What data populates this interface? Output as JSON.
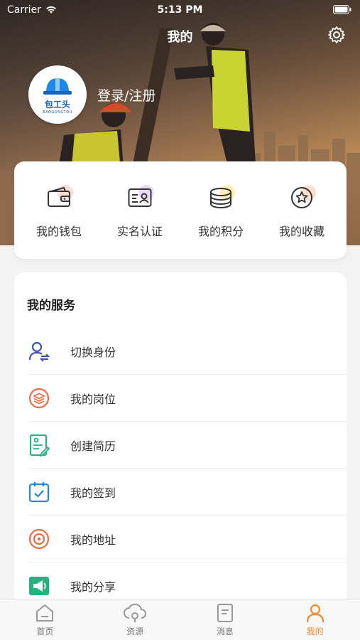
{
  "status_bar": {
    "carrier": "Carrier",
    "time": "5:13 PM"
  },
  "header": {
    "title": "我的"
  },
  "profile": {
    "brand": "包工头",
    "brand_sub": "BAOGONGTOU",
    "login_label": "登录/注册"
  },
  "quick_actions": [
    {
      "label": "我的钱包",
      "icon": "wallet-icon"
    },
    {
      "label": "实名认证",
      "icon": "id-card-icon"
    },
    {
      "label": "我的积分",
      "icon": "coins-icon"
    },
    {
      "label": "我的收藏",
      "icon": "star-icon"
    }
  ],
  "services": {
    "title": "我的服务",
    "items": [
      {
        "label": "切换身份",
        "icon": "switch-identity-icon"
      },
      {
        "label": "我的岗位",
        "icon": "layers-icon"
      },
      {
        "label": "创建简历",
        "icon": "resume-icon"
      },
      {
        "label": "我的签到",
        "icon": "calendar-check-icon"
      },
      {
        "label": "我的地址",
        "icon": "location-icon"
      },
      {
        "label": "我的分享",
        "icon": "megaphone-icon"
      }
    ]
  },
  "tabbar": [
    {
      "label": "首页",
      "icon": "home-icon"
    },
    {
      "label": "资源",
      "icon": "cloud-icon"
    },
    {
      "label": "消息",
      "icon": "message-icon"
    },
    {
      "label": "我的",
      "icon": "user-icon",
      "active": true
    }
  ],
  "colors": {
    "accent": "#f08a2c",
    "brand": "#1565c0",
    "background": "#f3f3f3"
  }
}
